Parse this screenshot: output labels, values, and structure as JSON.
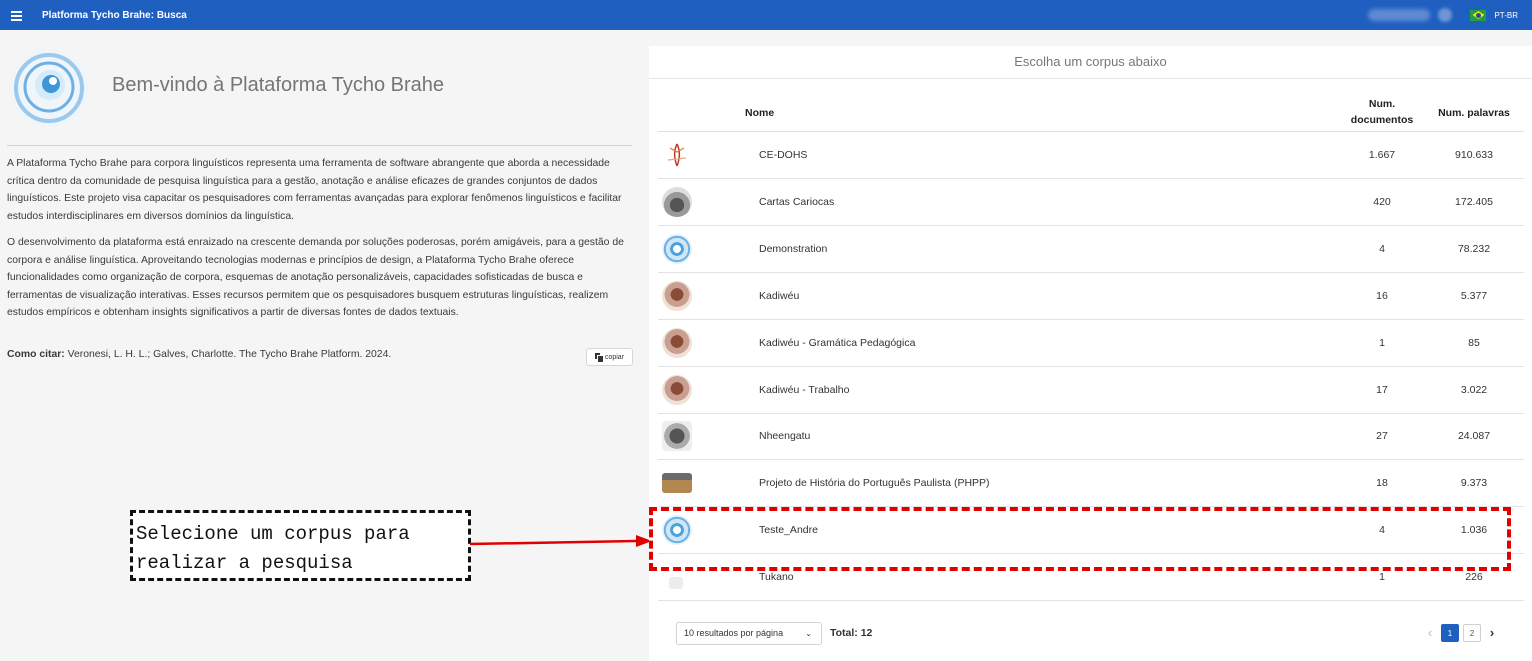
{
  "topbar": {
    "title": "Platforma Tycho Brahe: Busca",
    "language": "PT-BR"
  },
  "welcome": {
    "title": "Bem-vindo à Plataforma Tycho Brahe",
    "paragraph1": "A Plataforma Tycho Brahe para corpora linguísticos representa uma ferramenta de software abrangente que aborda a necessidade crítica dentro da comunidade de pesquisa linguística para a gestão, anotação e análise eficazes de grandes conjuntos de dados linguísticos. Este projeto visa capacitar os pesquisadores com ferramentas avançadas para explorar fenômenos linguísticos e facilitar estudos interdisciplinares em diversos domínios da linguística.",
    "paragraph2": "O desenvolvimento da plataforma está enraizado na crescente demanda por soluções poderosas, porém amigáveis, para a gestão de corpora e análise linguística. Aproveitando tecnologias modernas e princípios de design, a Plataforma Tycho Brahe oferece funcionalidades como organização de corpora, esquemas de anotação personalizáveis, capacidades sofisticadas de busca e ferramentas de visualização interativas. Esses recursos permitem que os pesquisadores busquem estruturas linguísticas, realizem estudos empíricos e obtenham insights significativos a partir de diversas fontes de dados textuais.",
    "cite_label": "Como citar:",
    "cite_text": "Veronesi, L. H. L.; Galves, Charlotte. The Tycho Brahe Platform. 2024.",
    "copy_label": "copiar"
  },
  "annotation": {
    "line1": "Selecione um corpus para",
    "line2": "realizar a pesquisa"
  },
  "corpus_table": {
    "header": "Escolha um corpus abaixo",
    "columns": {
      "name": "Nome",
      "docs_line1": "Num.",
      "docs_line2": "documentos",
      "words": "Num. palavras"
    },
    "rows": [
      {
        "name": "CE-DOHS",
        "docs": "1.667",
        "words": "910.633",
        "icon": "cedohs-logo-icon"
      },
      {
        "name": "Cartas Cariocas",
        "docs": "420",
        "words": "172.405",
        "icon": "cartas-cariocas-logo-icon"
      },
      {
        "name": "Demonstration",
        "docs": "4",
        "words": "78.232",
        "icon": "tycho-logo-icon"
      },
      {
        "name": "Kadiwéu",
        "docs": "16",
        "words": "5.377",
        "icon": "kadiweu-logo-icon"
      },
      {
        "name": "Kadiwéu - Gramática Pedagógica",
        "docs": "1",
        "words": "85",
        "icon": "kadiweu-logo-icon"
      },
      {
        "name": "Kadiwéu - Trabalho",
        "docs": "17",
        "words": "3.022",
        "icon": "kadiweu-logo-icon"
      },
      {
        "name": "Nheengatu",
        "docs": "27",
        "words": "24.087",
        "icon": "nheengatu-logo-icon"
      },
      {
        "name": "Projeto de História do Português Paulista (PHPP)",
        "docs": "18",
        "words": "9.373",
        "icon": "phpp-logo-icon"
      },
      {
        "name": "Teste_Andre",
        "docs": "4",
        "words": "1.036",
        "icon": "tycho-logo-icon"
      },
      {
        "name": "Tukano",
        "docs": "1",
        "words": "226",
        "icon": "tukano-logo-icon"
      }
    ],
    "rows_per_page": "10 resultados por página",
    "total": "Total: 12",
    "pages": [
      "1",
      "2"
    ],
    "current_page": "1"
  },
  "colors": {
    "topbar": "#1f5fbf",
    "highlight": "#e00000",
    "pager_active": "#1f5fbf"
  }
}
